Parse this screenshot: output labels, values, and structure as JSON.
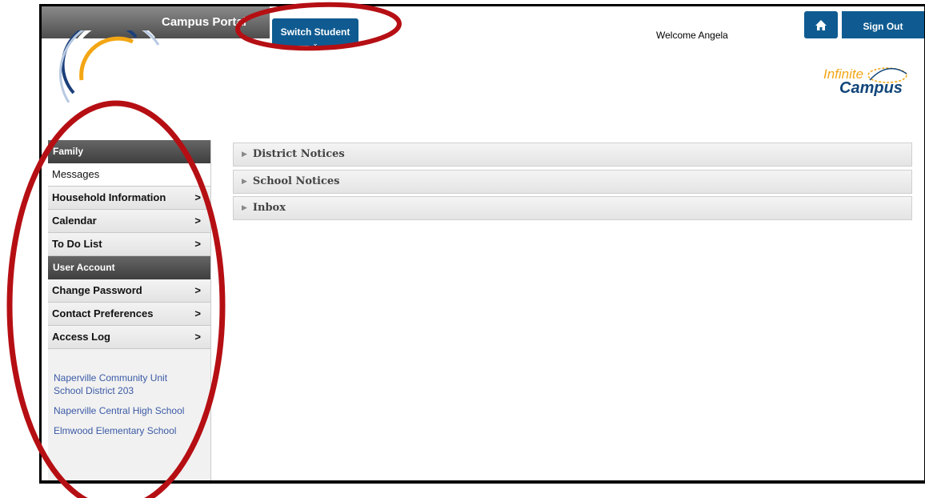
{
  "header": {
    "portal_title": "Campus Portal",
    "switch_student_label": "Switch Student",
    "welcome_text": "Welcome Angela",
    "home_icon": "home-icon",
    "sign_out_label": "Sign Out",
    "brand_line1": "Infinite",
    "brand_line2": "Campus"
  },
  "sidebar": {
    "sections": [
      {
        "heading": "Family",
        "items": [
          {
            "label": "Messages",
            "active": true
          },
          {
            "label": "Household Information",
            "chevron": ">"
          },
          {
            "label": "Calendar",
            "chevron": ">"
          },
          {
            "label": "To Do List",
            "chevron": ">"
          }
        ]
      },
      {
        "heading": "User Account",
        "items": [
          {
            "label": "Change Password",
            "chevron": ">"
          },
          {
            "label": "Contact Preferences",
            "chevron": ">"
          },
          {
            "label": "Access Log",
            "chevron": ">"
          }
        ]
      }
    ],
    "school_links": [
      "Naperville Community Unit School District 203",
      "Naperville Central High School",
      "Elmwood Elementary School"
    ]
  },
  "main": {
    "panels": [
      {
        "label": "District Notices"
      },
      {
        "label": "School Notices"
      },
      {
        "label": "Inbox"
      }
    ]
  },
  "colors": {
    "primary_blue": "#0f5b91",
    "annotation_red": "#b50f14",
    "brand_orange": "#f3a614"
  }
}
